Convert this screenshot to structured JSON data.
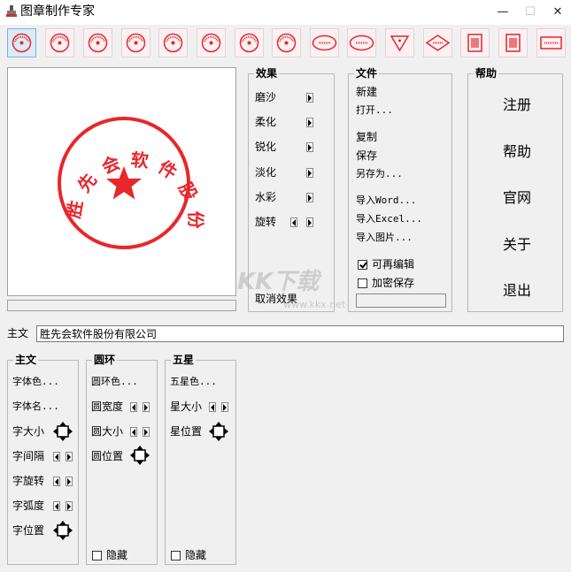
{
  "window": {
    "title": "图章制作专家",
    "min_glyph": "—",
    "max_glyph": "☐",
    "close_glyph": "✕"
  },
  "toolbar": {
    "icons": [
      "round-seal-1",
      "round-seal-2",
      "round-seal-3",
      "round-seal-4",
      "round-seal-5",
      "round-seal-6",
      "round-seal-7",
      "round-seal-8",
      "oval-seal-1",
      "oval-seal-2",
      "triangle-seal",
      "diamond-seal",
      "square-seal-1",
      "square-seal-2",
      "rect-seal"
    ],
    "selected_index": 0
  },
  "stamp": {
    "text": "胜先会软件股份有限公司",
    "color": "#e8262b"
  },
  "effects": {
    "title": "效果",
    "items": [
      "磨沙",
      "柔化",
      "锐化",
      "淡化",
      "水彩",
      "旋转"
    ],
    "cancel": "取消效果"
  },
  "file": {
    "title": "文件",
    "new": "新建",
    "open": "打开...",
    "copy": "复制",
    "save": "保存",
    "save_as": "另存为...",
    "export_word": "导入Word...",
    "export_excel": "导入Excel...",
    "export_image": "导入图片...",
    "reeditable_label": "可再编辑",
    "reeditable_checked": true,
    "encrypt_label": "加密保存",
    "encrypt_checked": false
  },
  "help": {
    "title": "帮助",
    "register": "注册",
    "help": "帮助",
    "website": "官网",
    "about": "关于",
    "exit": "退出"
  },
  "main_text": {
    "label": "主文",
    "value": "胜先会软件股份有限公司"
  },
  "main_group": {
    "title": "主文",
    "font_color": "字体色...",
    "font_name": "字体名...",
    "font_size": "字大小",
    "spacing": "字间隔",
    "rotation": "字旋转",
    "arc": "字弧度",
    "position": "字位置"
  },
  "ring_group": {
    "title": "圆环",
    "color": "圆环色...",
    "width": "圆宽度",
    "size": "圆大小",
    "position": "圆位置",
    "hide_label": "隐藏",
    "hide_checked": false
  },
  "star_group": {
    "title": "五星",
    "color": "五星色...",
    "size": "星大小",
    "position": "星位置",
    "hide_label": "隐藏",
    "hide_checked": false
  },
  "watermark": {
    "text": "KK下载",
    "url": "www.kkx.net"
  }
}
